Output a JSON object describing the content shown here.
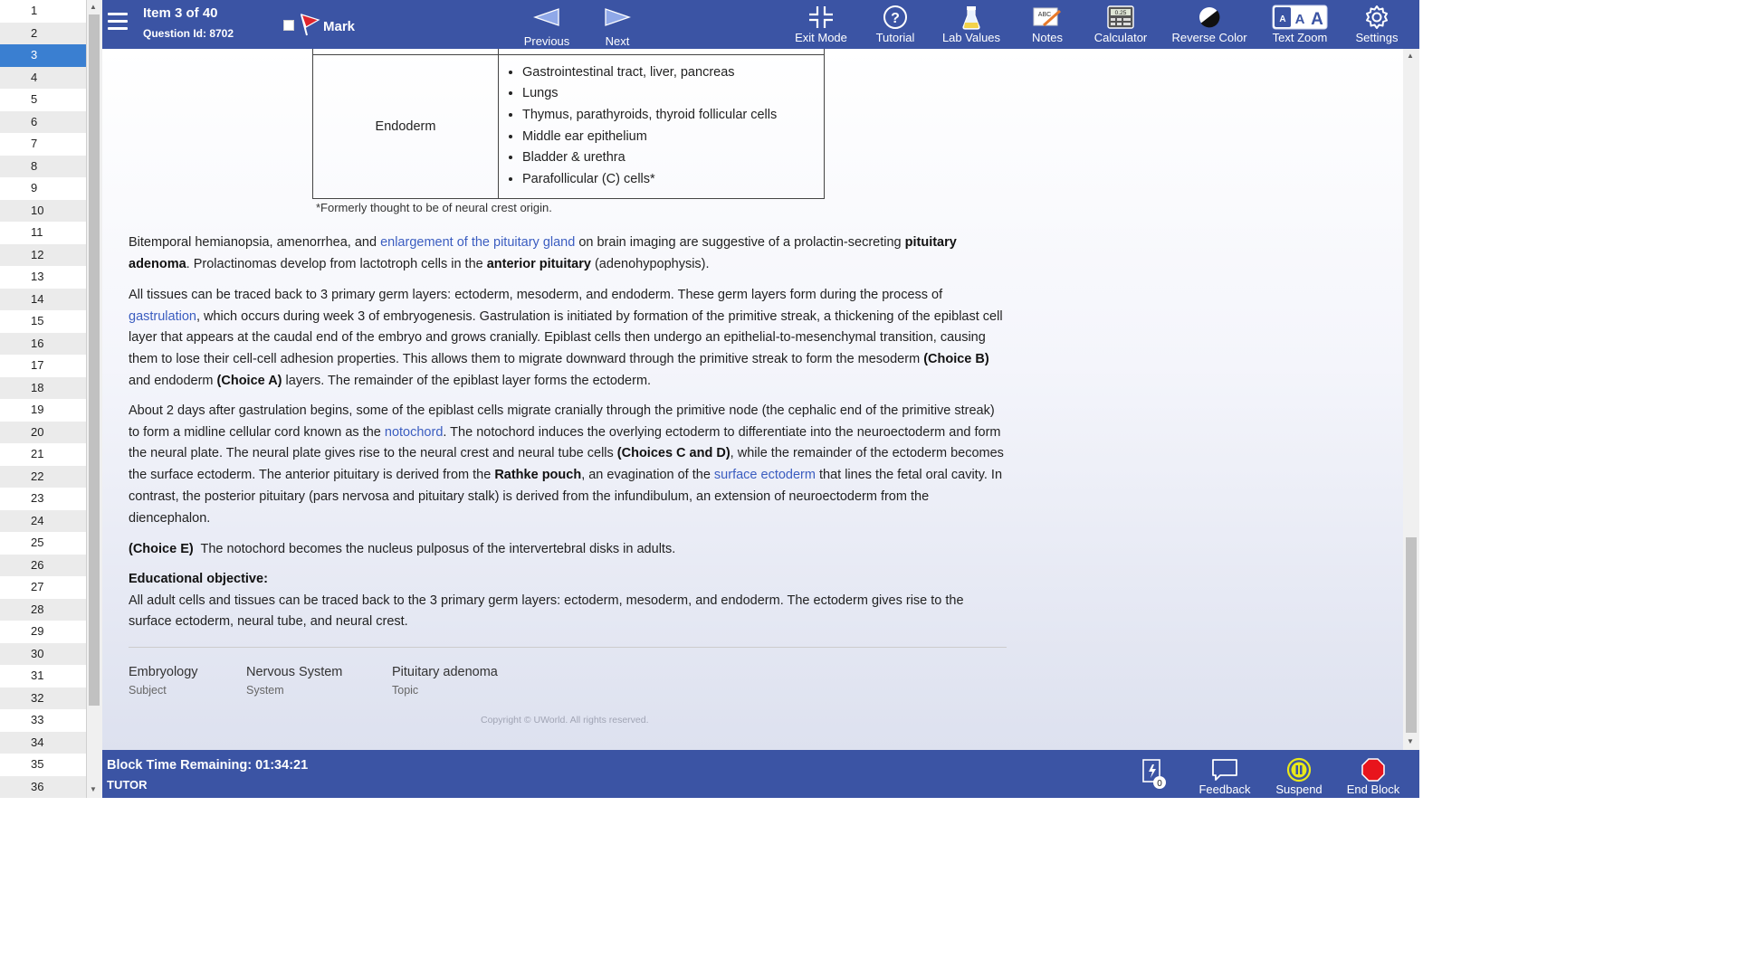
{
  "question_list": [
    "1",
    "2",
    "3",
    "4",
    "5",
    "6",
    "7",
    "8",
    "9",
    "10",
    "11",
    "12",
    "13",
    "14",
    "15",
    "16",
    "17",
    "18",
    "19",
    "20",
    "21",
    "22",
    "23",
    "24",
    "25",
    "26",
    "27",
    "28",
    "29",
    "30",
    "31",
    "32",
    "33",
    "34",
    "35",
    "36"
  ],
  "active_question": "3",
  "header": {
    "item_title": "Item 3 of 40",
    "question_id": "Question Id: 8702",
    "mark_label": "Mark",
    "previous": "Previous",
    "next": "Next",
    "exit_mode": "Exit Mode",
    "tutorial": "Tutorial",
    "lab_values": "Lab Values",
    "notes": "Notes",
    "calculator": "Calculator",
    "reverse_color": "Reverse Color",
    "text_zoom": "Text Zoom",
    "settings": "Settings",
    "notes_icon_text": "ABC",
    "calculator_icon_text": "0.25",
    "zoom_letters": [
      "A",
      "A",
      "A"
    ]
  },
  "table": {
    "layer": "Endoderm",
    "items": [
      "Gastrointestinal tract, liver, pancreas",
      "Lungs",
      "Thymus, parathyroids, thyroid follicular cells",
      "Middle ear epithelium",
      "Bladder & urethra",
      "Parafollicular (C) cells*"
    ],
    "footnote": "*Formerly thought to be of neural crest origin."
  },
  "explanation": {
    "p1": {
      "t1": "Bitemporal hemianopsia, amenorrhea, and ",
      "l1": "enlargement of the pituitary gland",
      "t2": " on brain imaging are suggestive of a prolactin-secreting ",
      "b1": "pituitary adenoma",
      "t3": ".  Prolactinomas develop from lactotroph cells in the ",
      "b2": "anterior pituitary",
      "t4": " (adenohypophysis)."
    },
    "p2": {
      "t1": "All tissues can be traced back to 3 primary germ layers: ectoderm, mesoderm, and endoderm.  These germ layers form during the process of ",
      "l1": "gastrulation",
      "t2": ", which occurs during week 3 of embryogenesis.  Gastrulation is initiated by formation of the primitive streak, a thickening of the epiblast cell layer that appears at the caudal end of the embryo and grows cranially.  Epiblast cells then undergo an epithelial-to-mesenchymal transition, causing them to lose their cell-cell adhesion properties.  This allows them to migrate downward through the primitive streak to form the mesoderm ",
      "b1": "(Choice B)",
      "t3": " and endoderm ",
      "b2": "(Choice A)",
      "t4": " layers.  The remainder of the epiblast layer forms the ectoderm."
    },
    "p3": {
      "t1": "About 2 days after gastrulation begins, some of the epiblast cells migrate cranially through the primitive node (the cephalic end of the primitive streak) to form a midline cellular cord known as the ",
      "l1": "notochord",
      "t2": ".  The notochord induces the overlying ectoderm to differentiate into the neuroectoderm and form the neural plate.  The neural plate gives rise to the neural crest and neural tube cells ",
      "b1": "(Choices C and D)",
      "t3": ", while the remainder of the ectoderm becomes the surface ectoderm.  The anterior pituitary is derived from the ",
      "b2": "Rathke pouch",
      "t4": ", an evagination of the ",
      "l2": "surface ectoderm",
      "t5": " that lines the fetal oral cavity.  In contrast, the posterior pituitary (pars nervosa and pituitary stalk) is derived from the infundibulum, an extension of neuroectoderm from the diencephalon."
    },
    "p4": {
      "b1": "(Choice E)",
      "t1": "  The notochord becomes the nucleus pulposus of the intervertebral disks in adults."
    },
    "objective_title": "Educational objective:",
    "objective_text": "All adult cells and tissues can be traced back to the 3 primary germ layers: ectoderm, mesoderm, and endoderm.  The ectoderm gives rise to the surface ectoderm, neural tube, and neural crest."
  },
  "categories": [
    {
      "value": "Embryology",
      "key": "Subject"
    },
    {
      "value": "Nervous System",
      "key": "System"
    },
    {
      "value": "Pituitary adenoma",
      "key": "Topic"
    }
  ],
  "copyright": "Copyright © UWorld. All rights reserved.",
  "footer": {
    "timer": "Block Time Remaining: 01:34:21",
    "mode": "TUTOR",
    "flash_count": "0",
    "feedback": "Feedback",
    "suspend": "Suspend",
    "end_block": "End Block"
  },
  "colors": {
    "bar": "#3b54a4",
    "active_item": "#3a7fd1",
    "link": "#3b5dc0",
    "flag": "#e0242c",
    "suspend": "#e8e81a",
    "end_block": "#e8141c"
  }
}
